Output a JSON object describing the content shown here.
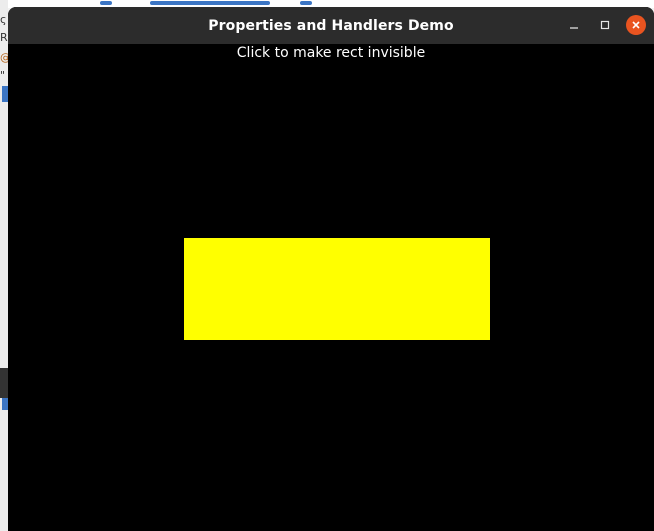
{
  "window": {
    "title": "Properties and Handlers Demo",
    "controls": {
      "minimize_icon": "minimize-icon",
      "maximize_icon": "maximize-icon",
      "close_icon": "close-icon"
    }
  },
  "canvas": {
    "instructions": "Click to make rect invisible",
    "background_color": "#000000",
    "rect_color": "#ffff00"
  },
  "background_app": {
    "left_glyphs": [
      "ς",
      "R",
      "@",
      "\""
    ]
  },
  "colors": {
    "titlebar": "#2c2c2c",
    "close_button": "#e95420"
  }
}
